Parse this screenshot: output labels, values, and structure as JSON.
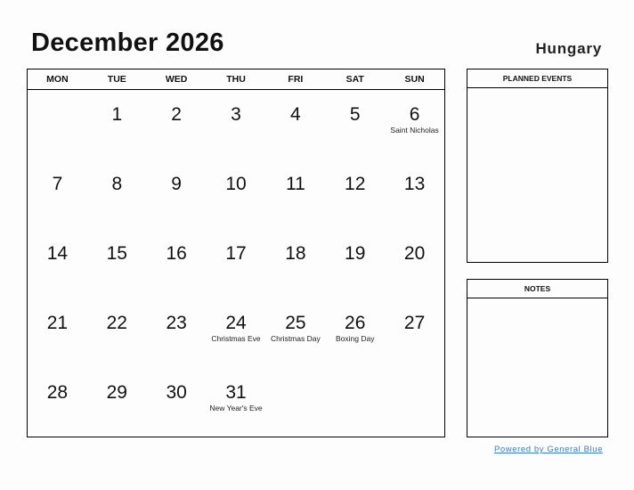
{
  "header": {
    "title": "December 2026",
    "country": "Hungary"
  },
  "calendar": {
    "weekdays": [
      "MON",
      "TUE",
      "WED",
      "THU",
      "FRI",
      "SAT",
      "SUN"
    ],
    "weeks": [
      [
        {
          "day": "",
          "event": ""
        },
        {
          "day": "1",
          "event": ""
        },
        {
          "day": "2",
          "event": ""
        },
        {
          "day": "3",
          "event": ""
        },
        {
          "day": "4",
          "event": ""
        },
        {
          "day": "5",
          "event": ""
        },
        {
          "day": "6",
          "event": "Saint Nicholas"
        }
      ],
      [
        {
          "day": "7",
          "event": ""
        },
        {
          "day": "8",
          "event": ""
        },
        {
          "day": "9",
          "event": ""
        },
        {
          "day": "10",
          "event": ""
        },
        {
          "day": "11",
          "event": ""
        },
        {
          "day": "12",
          "event": ""
        },
        {
          "day": "13",
          "event": ""
        }
      ],
      [
        {
          "day": "14",
          "event": ""
        },
        {
          "day": "15",
          "event": ""
        },
        {
          "day": "16",
          "event": ""
        },
        {
          "day": "17",
          "event": ""
        },
        {
          "day": "18",
          "event": ""
        },
        {
          "day": "19",
          "event": ""
        },
        {
          "day": "20",
          "event": ""
        }
      ],
      [
        {
          "day": "21",
          "event": ""
        },
        {
          "day": "22",
          "event": ""
        },
        {
          "day": "23",
          "event": ""
        },
        {
          "day": "24",
          "event": "Christmas Eve"
        },
        {
          "day": "25",
          "event": "Christmas Day"
        },
        {
          "day": "26",
          "event": "Boxing Day"
        },
        {
          "day": "27",
          "event": ""
        }
      ],
      [
        {
          "day": "28",
          "event": ""
        },
        {
          "day": "29",
          "event": ""
        },
        {
          "day": "30",
          "event": ""
        },
        {
          "day": "31",
          "event": "New Year's Eve"
        },
        {
          "day": "",
          "event": ""
        },
        {
          "day": "",
          "event": ""
        },
        {
          "day": "",
          "event": ""
        }
      ]
    ]
  },
  "side": {
    "planned_events_label": "PLANNED EVENTS",
    "notes_label": "NOTES"
  },
  "footer": {
    "powered_by": "Powered by General Blue",
    "link_color": "#3b7bbf"
  }
}
